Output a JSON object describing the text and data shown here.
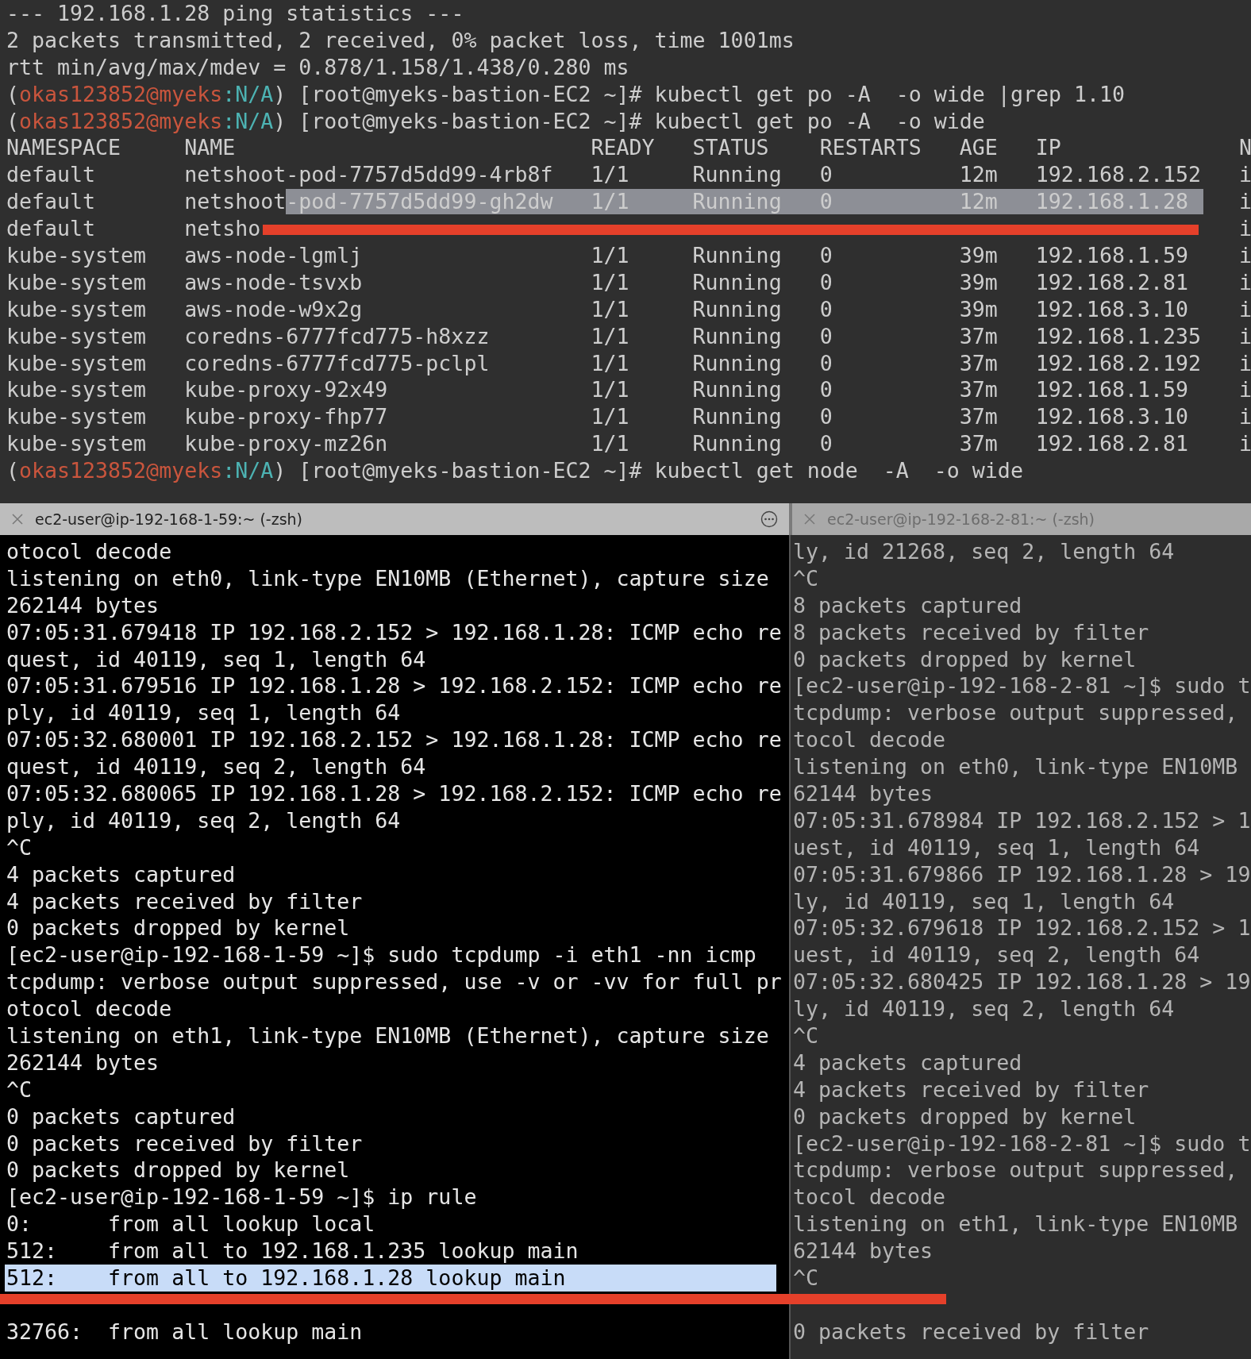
{
  "top_terminal": {
    "lines_before": [
      [
        {
          "text": "--- 192.168.1.28 ping statistics ---",
          "kind": "plain"
        }
      ],
      [
        {
          "text": "2 packets transmitted, 2 received, 0% packet loss, time 1001ms",
          "kind": "plain"
        }
      ],
      [
        {
          "text": "rtt min/avg/max/mdev = 0.878/1.158/1.438/0.280 ms",
          "kind": "plain"
        }
      ],
      [
        {
          "text": "(",
          "kind": "plain"
        },
        {
          "text": "okas123852@myeks",
          "kind": "user"
        },
        {
          "text": ":N/A",
          "kind": "context"
        },
        {
          "text": ") [root@myeks-bastion-EC2 ~]# kubectl get po -A  -o wide |grep 1.10",
          "kind": "plain"
        }
      ],
      [
        {
          "text": "(",
          "kind": "plain"
        },
        {
          "text": "okas123852@myeks",
          "kind": "user"
        },
        {
          "text": ":N/A",
          "kind": "context"
        },
        {
          "text": ") [root@myeks-bastion-EC2 ~]# kubectl get po -A  -o wide",
          "kind": "plain"
        }
      ]
    ],
    "table": {
      "columns": [
        "NAMESPACE",
        "NAME",
        "READY",
        "STATUS",
        "RESTARTS",
        "AGE",
        "IP",
        "N"
      ],
      "rows": [
        {
          "cells": [
            "default",
            "netshoot-pod-7757d5dd99-4rb8f",
            "1/1",
            "Running",
            "0",
            "12m",
            "192.168.2.152",
            "i"
          ],
          "selected": false
        },
        {
          "cells": [
            "default",
            "netshoot-pod-7757d5dd99-gh2dw",
            "1/1",
            "Running",
            "0",
            "12m",
            "192.168.1.28",
            "i"
          ],
          "selected": true
        },
        {
          "cells": [
            "default",
            "netsho",
            "",
            "",
            "",
            "",
            "",
            "i"
          ],
          "selected": false
        },
        {
          "cells": [
            "kube-system",
            "aws-node-lgmlj",
            "1/1",
            "Running",
            "0",
            "39m",
            "192.168.1.59",
            "i"
          ],
          "selected": false
        },
        {
          "cells": [
            "kube-system",
            "aws-node-tsvxb",
            "1/1",
            "Running",
            "0",
            "39m",
            "192.168.2.81",
            "i"
          ],
          "selected": false
        },
        {
          "cells": [
            "kube-system",
            "aws-node-w9x2g",
            "1/1",
            "Running",
            "0",
            "39m",
            "192.168.3.10",
            "i"
          ],
          "selected": false
        },
        {
          "cells": [
            "kube-system",
            "coredns-6777fcd775-h8xzz",
            "1/1",
            "Running",
            "0",
            "37m",
            "192.168.1.235",
            "i"
          ],
          "selected": false
        },
        {
          "cells": [
            "kube-system",
            "coredns-6777fcd775-pclpl",
            "1/1",
            "Running",
            "0",
            "37m",
            "192.168.2.192",
            "i"
          ],
          "selected": false
        },
        {
          "cells": [
            "kube-system",
            "kube-proxy-92x49",
            "1/1",
            "Running",
            "0",
            "37m",
            "192.168.1.59",
            "i"
          ],
          "selected": false
        },
        {
          "cells": [
            "kube-system",
            "kube-proxy-fhp77",
            "1/1",
            "Running",
            "0",
            "37m",
            "192.168.3.10",
            "i"
          ],
          "selected": false
        },
        {
          "cells": [
            "kube-system",
            "kube-proxy-mz26n",
            "1/1",
            "Running",
            "0",
            "37m",
            "192.168.2.81",
            "i"
          ],
          "selected": false
        }
      ]
    },
    "lines_after": [
      [
        {
          "text": "(",
          "kind": "plain"
        },
        {
          "text": "okas123852@myeks",
          "kind": "user"
        },
        {
          "text": ":N/A",
          "kind": "context"
        },
        {
          "text": ") [root@myeks-bastion-EC2 ~]# kubectl get node  -A  -o wide",
          "kind": "plain"
        }
      ]
    ]
  },
  "tabs": [
    {
      "title": "ec2-user@ip-192-168-1-59:~ (-zsh)",
      "selected": true
    },
    {
      "title": "ec2-user@ip-192-168-2-81:~ (-zsh)",
      "selected": false
    }
  ],
  "left_pane": {
    "lines": [
      {
        "text": "otocol decode",
        "selected": false
      },
      {
        "text": "listening on eth0, link-type EN10MB (Ethernet), capture size",
        "selected": false
      },
      {
        "text": "262144 bytes",
        "selected": false
      },
      {
        "text": "07:05:31.679418 IP 192.168.2.152 > 192.168.1.28: ICMP echo re",
        "selected": false
      },
      {
        "text": "quest, id 40119, seq 1, length 64",
        "selected": false
      },
      {
        "text": "07:05:31.679516 IP 192.168.1.28 > 192.168.2.152: ICMP echo re",
        "selected": false
      },
      {
        "text": "ply, id 40119, seq 1, length 64",
        "selected": false
      },
      {
        "text": "07:05:32.680001 IP 192.168.2.152 > 192.168.1.28: ICMP echo re",
        "selected": false
      },
      {
        "text": "quest, id 40119, seq 2, length 64",
        "selected": false
      },
      {
        "text": "07:05:32.680065 IP 192.168.1.28 > 192.168.2.152: ICMP echo re",
        "selected": false
      },
      {
        "text": "ply, id 40119, seq 2, length 64",
        "selected": false
      },
      {
        "text": "^C",
        "selected": false
      },
      {
        "text": "4 packets captured",
        "selected": false
      },
      {
        "text": "4 packets received by filter",
        "selected": false
      },
      {
        "text": "0 packets dropped by kernel",
        "selected": false
      },
      {
        "text": "[ec2-user@ip-192-168-1-59 ~]$ sudo tcpdump -i eth1 -nn icmp",
        "selected": false
      },
      {
        "text": "tcpdump: verbose output suppressed, use -v or -vv for full pr",
        "selected": false
      },
      {
        "text": "otocol decode",
        "selected": false
      },
      {
        "text": "listening on eth1, link-type EN10MB (Ethernet), capture size",
        "selected": false
      },
      {
        "text": "262144 bytes",
        "selected": false
      },
      {
        "text": "^C",
        "selected": false
      },
      {
        "text": "0 packets captured",
        "selected": false
      },
      {
        "text": "0 packets received by filter",
        "selected": false
      },
      {
        "text": "0 packets dropped by kernel",
        "selected": false
      },
      {
        "text": "[ec2-user@ip-192-168-1-59 ~]$ ip rule",
        "selected": false
      },
      {
        "text": "0:      from all lookup local",
        "selected": false
      },
      {
        "text": "512:    from all to 192.168.1.235 lookup main",
        "selected": false
      },
      {
        "text": "512:    from all to 192.168.1.28 lookup main",
        "selected": true
      }
    ],
    "lines_below_mark": [
      {
        "text": "32766:  from all lookup main",
        "selected": false
      }
    ]
  },
  "right_pane": {
    "lines": [
      "ly, id 21268, seq 2, length 64",
      "^C",
      "8 packets captured",
      "8 packets received by filter",
      "0 packets dropped by kernel",
      "[ec2-user@ip-192-168-2-81 ~]$ sudo t",
      "tcpdump: verbose output suppressed,",
      "tocol decode",
      "listening on eth0, link-type EN10MB",
      "62144 bytes",
      "07:05:31.678984 IP 192.168.2.152 > 1",
      "uest, id 40119, seq 1, length 64",
      "07:05:31.679866 IP 192.168.1.28 > 19",
      "ly, id 40119, seq 1, length 64",
      "07:05:32.679618 IP 192.168.2.152 > 1",
      "uest, id 40119, seq 2, length 64",
      "07:05:32.680425 IP 192.168.1.28 > 19",
      "ly, id 40119, seq 2, length 64",
      "^C",
      "4 packets captured",
      "4 packets received by filter",
      "0 packets dropped by kernel",
      "[ec2-user@ip-192-168-2-81 ~]$ sudo t",
      "tcpdump: verbose output suppressed,",
      "tocol decode",
      "listening on eth1, link-type EN10MB",
      "62144 bytes",
      "^C"
    ],
    "lines_below_mark": [
      "0 packets received by filter"
    ]
  }
}
